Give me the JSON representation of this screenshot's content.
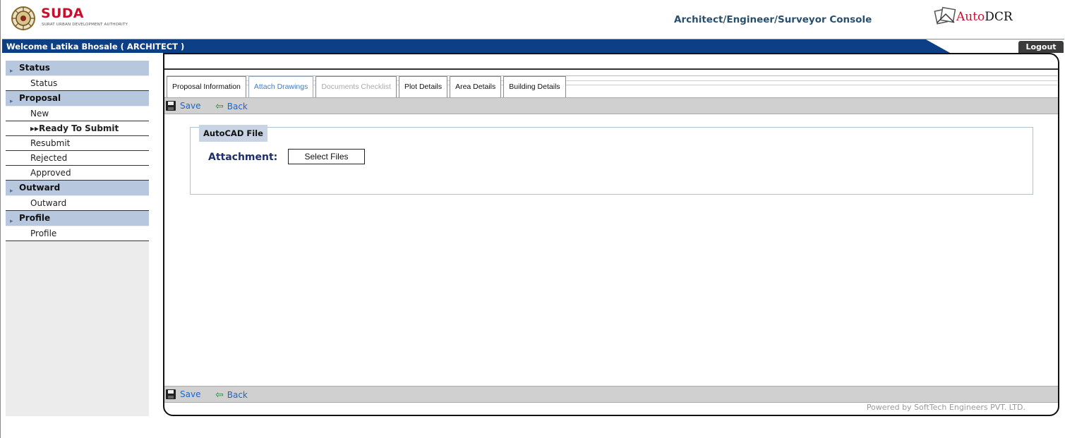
{
  "header": {
    "brand": "SUDA",
    "brand_subtitle": "SURAT URBAN DEVELOPMENT AUTHORITY",
    "console_title": "Architect/Engineer/Surveyor Console",
    "product_name_prefix": "Auto",
    "product_name_suffix": "DCR",
    "logo_icon": "suda-emblem-icon",
    "product_icon": "autodcr-logo-icon"
  },
  "welcome": {
    "text": "Welcome Latika Bhosale ( ARCHITECT )",
    "logout_label": "Logout"
  },
  "sidebar": {
    "sections": [
      {
        "title": "Status",
        "items": [
          {
            "label": "Status",
            "active": false
          }
        ]
      },
      {
        "title": "Proposal",
        "items": [
          {
            "label": "New",
            "active": false
          },
          {
            "label": "Ready To Submit",
            "active": true,
            "prefix": "▸▸"
          },
          {
            "label": "Resubmit",
            "active": false
          },
          {
            "label": "Rejected",
            "active": false
          },
          {
            "label": "Approved",
            "active": false
          }
        ]
      },
      {
        "title": "Outward",
        "items": [
          {
            "label": "Outward",
            "active": false
          }
        ]
      },
      {
        "title": "Profile",
        "items": [
          {
            "label": "Profile",
            "active": false
          }
        ]
      }
    ]
  },
  "tabs": [
    {
      "label": "Proposal Information",
      "state": "normal"
    },
    {
      "label": "Attach Drawings",
      "state": "selected"
    },
    {
      "label": "Documents Checklist",
      "state": "disabled"
    },
    {
      "label": "Plot Details",
      "state": "normal"
    },
    {
      "label": "Area Details",
      "state": "normal"
    },
    {
      "label": "Building Details",
      "state": "normal"
    }
  ],
  "toolbar": {
    "save_label": "Save",
    "back_label": "Back"
  },
  "autocad": {
    "legend": "AutoCAD File",
    "attachment_label": "Attachment:",
    "select_files_label": "Select Files"
  },
  "footer": {
    "powered_by": "Powered by SoftTech Engineers PVT. LTD."
  },
  "colors": {
    "welcome_bar": "#0c3f86",
    "sidebar_header": "#b7c7de",
    "link": "#2266c4",
    "brand_red": "#c8102e"
  }
}
